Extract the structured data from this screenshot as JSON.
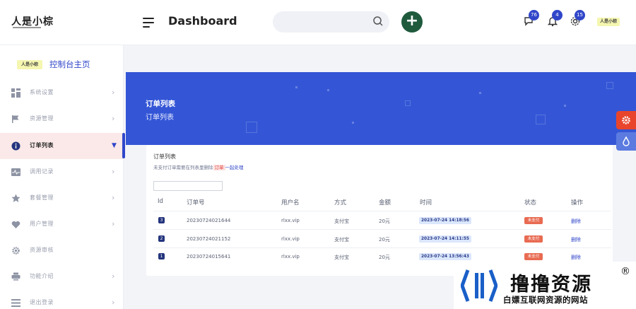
{
  "header": {
    "logo_text": "人是小棕",
    "page_title": "Dashboard",
    "search_placeholder": "",
    "add_label": "+",
    "badges": {
      "messages": "76",
      "notifications": "4",
      "settings": "15"
    },
    "avatar_text": "人是小棕"
  },
  "sidebar": {
    "console_logo_text": "人是小棕",
    "console_label": "控制台主页",
    "items": [
      {
        "label": "系统设置",
        "icon": "grid-icon"
      },
      {
        "label": "资源管理",
        "icon": "flag-icon"
      },
      {
        "label": "订单列表",
        "icon": "info-icon",
        "active": true
      },
      {
        "label": "调用记录",
        "icon": "pulse-icon"
      },
      {
        "label": "套餐管理",
        "icon": "star-icon"
      },
      {
        "label": "用户管理",
        "icon": "heart-icon"
      },
      {
        "label": "资源审核",
        "icon": "gear-icon"
      },
      {
        "label": "功能介绍",
        "icon": "printer-icon"
      },
      {
        "label": "退出登录",
        "icon": "menu-icon"
      }
    ]
  },
  "hero": {
    "title": "订单列表",
    "subtitle": "订单列表"
  },
  "card": {
    "title": "订单列表",
    "note_prefix": "未支付订单需要在列表里删除",
    "note_highlight": "订单",
    "note_suffix": "一起处理",
    "filter_value": "",
    "columns": [
      "Id",
      "订单号",
      "用户名",
      "方式",
      "金额",
      "时间",
      "状态",
      "操作"
    ],
    "rows": [
      {
        "id": "3",
        "order": "20230724021644",
        "user": "rlxx.vip",
        "method": "支付宝",
        "amount": "20元",
        "time": "2023-07-24 14:18:56",
        "status": "未支付",
        "action": "删除"
      },
      {
        "id": "2",
        "order": "20230724021152",
        "user": "rlxx.vip",
        "method": "支付宝",
        "amount": "20元",
        "time": "2023-07-24 14:11:55",
        "status": "未支付",
        "action": "删除"
      },
      {
        "id": "1",
        "order": "20230724015641",
        "user": "rlxx.vip",
        "method": "支付宝",
        "amount": "20元",
        "time": "2023-07-24 13:56:43",
        "status": "未支付",
        "action": "删除"
      }
    ]
  },
  "watermark": {
    "title": "撸撸资源",
    "subtitle": "白嫖互联网资源的网站",
    "reg": "®"
  },
  "colors": {
    "primary": "#3456d6",
    "accent_green": "#1f5a3d",
    "status_red": "#e86b52",
    "fab_red": "#e8452c",
    "fab_blue": "#5b7be0"
  }
}
